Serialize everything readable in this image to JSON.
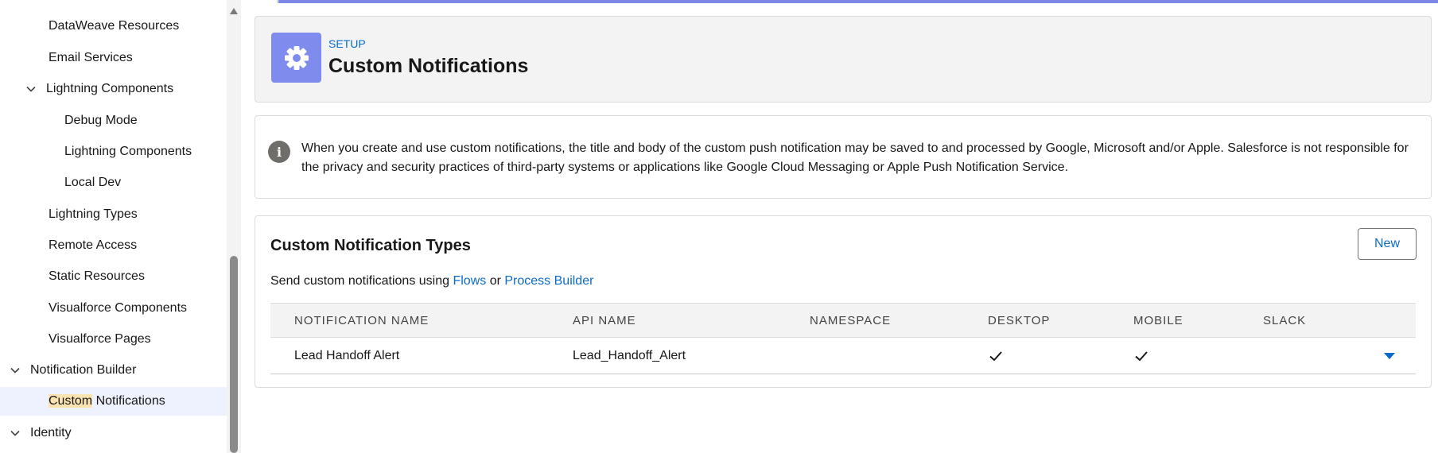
{
  "sidebar": {
    "items": [
      {
        "label": "DataWeave Resources"
      },
      {
        "label": "Email Services"
      },
      {
        "label": "Lightning Components"
      },
      {
        "label": "Debug Mode"
      },
      {
        "label": "Lightning Components"
      },
      {
        "label": "Local Dev"
      },
      {
        "label": "Lightning Types"
      },
      {
        "label": "Remote Access"
      },
      {
        "label": "Static Resources"
      },
      {
        "label": "Visualforce Components"
      },
      {
        "label": "Visualforce Pages"
      },
      {
        "label": "Notification Builder"
      },
      {
        "label_highlight": "Custom",
        "label_rest": " Notifications"
      },
      {
        "label": "Identity"
      }
    ]
  },
  "header": {
    "eyebrow": "SETUP",
    "title": "Custom Notifications",
    "icon": "gear-icon"
  },
  "info": {
    "icon": "info-icon",
    "text": "When you create and use custom notifications, the title and body of the custom push notification may be saved to and processed by Google, Microsoft and/or Apple. Salesforce is not responsible for the privacy and security practices of third-party systems or applications like Google Cloud Messaging or Apple Push Notification Service."
  },
  "types": {
    "title": "Custom Notification Types",
    "new_label": "New",
    "desc_prefix": "Send custom notifications using ",
    "link_flows": "Flows",
    "desc_or": " or ",
    "link_process_builder": "Process Builder",
    "columns": [
      "Notification Name",
      "API Name",
      "Namespace",
      "Desktop",
      "Mobile",
      "Slack"
    ],
    "rows": [
      {
        "name": "Lead Handoff Alert",
        "api_name": "Lead_Handoff_Alert",
        "namespace": "",
        "desktop": true,
        "mobile": true,
        "slack": false
      }
    ]
  },
  "colors": {
    "accent": "#7f8ced",
    "link": "#0b6bcb",
    "selected_bg": "#eef1fe",
    "highlight": "#fbe3b1"
  }
}
